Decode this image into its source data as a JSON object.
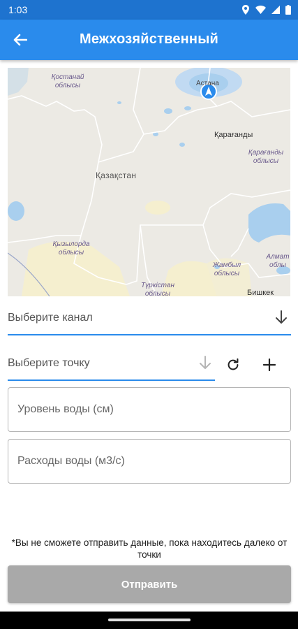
{
  "status_bar": {
    "time": "1:03",
    "icons": [
      "location-icon",
      "wifi-icon",
      "signal-icon",
      "battery-icon"
    ]
  },
  "app_bar": {
    "title": "Межхозяйственный",
    "back_icon": "arrow-left-icon"
  },
  "map": {
    "labels": {
      "kostanay": "Қостанай облысы",
      "astana": "Астана",
      "karaganda_city": "Қарағанды",
      "karaganda_region": "Қарағанды облысы",
      "kazakhstan": "Қазақстан",
      "kyzylorda": "Қызылорда облысы",
      "zhambyl": "Жамбыл облысы",
      "almaty": "Алмат облы",
      "turkistan": "Түркістан облысы",
      "bishkek": "Бишкек"
    },
    "marker_icon": "navigation-arrow-icon",
    "colors": {
      "land": "#eceae4",
      "water": "#a9cfee",
      "border": "#ffffff",
      "sand": "#f5efcf",
      "marker": "#2a8bec"
    }
  },
  "form": {
    "channel_dropdown": {
      "placeholder": "Выберите канал",
      "arrow_icon": "arrow-down-icon"
    },
    "point_dropdown": {
      "placeholder": "Выберите точку",
      "arrow_icon": "arrow-down-icon"
    },
    "refresh_icon": "refresh-icon",
    "add_icon": "plus-icon",
    "water_level": {
      "placeholder": "Уровень воды (см)",
      "value": ""
    },
    "water_flow": {
      "placeholder": "Расходы воды (м3/с)",
      "value": ""
    },
    "notice": "*Вы не сможете отправить данные, пока находитесь далеко от точки",
    "submit_label": "Отправить"
  },
  "colors": {
    "primary": "#2a8bec",
    "status_bar": "#1e73cf",
    "disabled_button": "#a9a9a9"
  }
}
